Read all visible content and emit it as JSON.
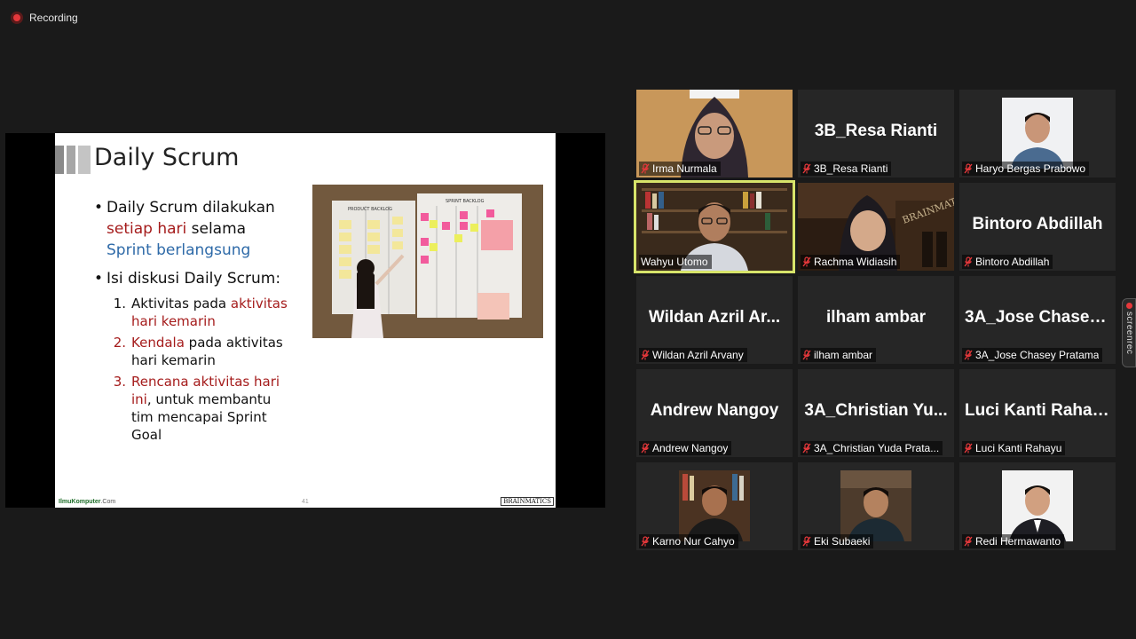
{
  "recording": {
    "label": "Recording"
  },
  "slide": {
    "title": "Daily Scrum",
    "bullet1": {
      "pre": "Daily Scrum dilakukan ",
      "red": "setiap hari",
      "mid": " selama ",
      "blue": "Sprint berlangsung"
    },
    "bullet2": "Isi diskusi Daily Scrum:",
    "sub1": {
      "num": "1.",
      "pre": "Aktivitas pada ",
      "red": "aktivitas hari kemarin"
    },
    "sub2": {
      "num": "2.",
      "red": "Kendala",
      "post": " pada aktivitas hari kemarin"
    },
    "sub3": {
      "num": "3.",
      "red": "Rencana aktivitas hari ini",
      "post": ", untuk membantu tim mencapai Sprint Goal"
    },
    "footer_left_main": "IlmuKomputer",
    "footer_left_suffix": ".Com",
    "page_number": "41",
    "footer_logo": "BRAINMATICS",
    "photo_labels": {
      "product_backlog": "PRODUCT BACKLOG",
      "sprint_backlog": "SPRINT BACKLOG"
    }
  },
  "participants": [
    {
      "name": "Irma Nurmala",
      "video": true
    },
    {
      "name": "3B_Resa Rianti",
      "display": "3B_Resa Rianti"
    },
    {
      "name": "Haryo Bergas Prabowo",
      "avatar": true
    },
    {
      "name": "Wahyu Utomo",
      "video": true,
      "speaking": true
    },
    {
      "name": "Rachma Widiasih",
      "video": true
    },
    {
      "name": "Bintoro Abdillah",
      "display": "Bintoro Abdillah"
    },
    {
      "name": "Wildan Azril Arvany",
      "display": "Wildan  Azril  Ar..."
    },
    {
      "name": "ilham ambar",
      "display": "ilham ambar"
    },
    {
      "name": "3A_Jose Chasey Pratama",
      "display": "3A_Jose  Chasey..."
    },
    {
      "name": "Andrew Nangoy",
      "display": "Andrew Nangoy"
    },
    {
      "name": "3A_Christian Yuda Prata...",
      "display": "3A_Christian  Yu..."
    },
    {
      "name": "Luci Kanti Rahayu",
      "display": "Luci Kanti Rahayu"
    },
    {
      "name": "Karno Nur Cahyo",
      "avatar": true
    },
    {
      "name": "Eki Subaeki",
      "avatar": true
    },
    {
      "name": "Redi Hermawanto",
      "avatar": true
    }
  ],
  "screenrec": {
    "label": "screenrec"
  },
  "colors": {
    "speaking_border": "#d7e46a",
    "muted_icon": "#e5383b",
    "slide_red": "#a51c1c",
    "slide_blue": "#2e6aa8"
  }
}
